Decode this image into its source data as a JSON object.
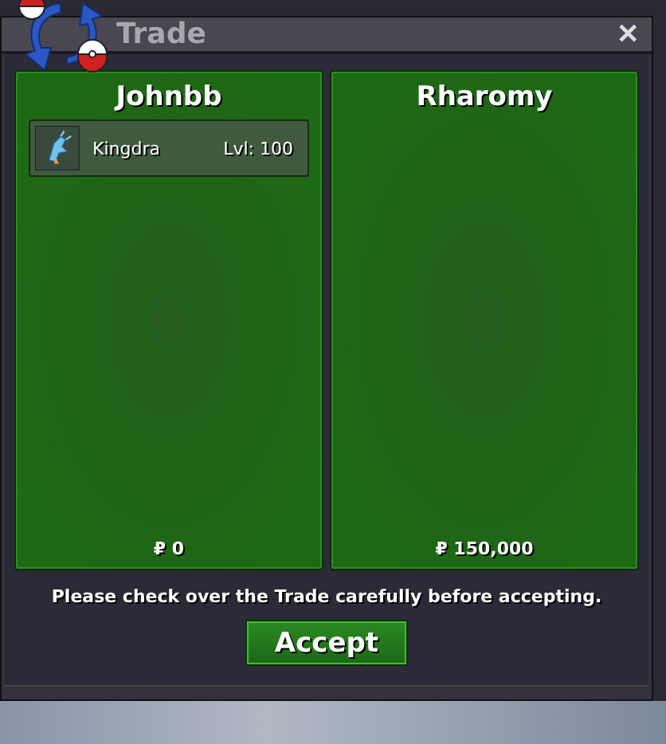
{
  "window": {
    "title": "Trade",
    "close": "✕"
  },
  "panels": [
    {
      "player": "Johnbb",
      "items": [
        {
          "name": "Kingdra",
          "level": "Lvl: 100"
        }
      ],
      "money": "₽ 0"
    },
    {
      "player": "Rharomy",
      "money": "₽ 150,000"
    }
  ],
  "message": "Please check over the Trade carefully before accepting.",
  "accept_button": "Accept"
}
